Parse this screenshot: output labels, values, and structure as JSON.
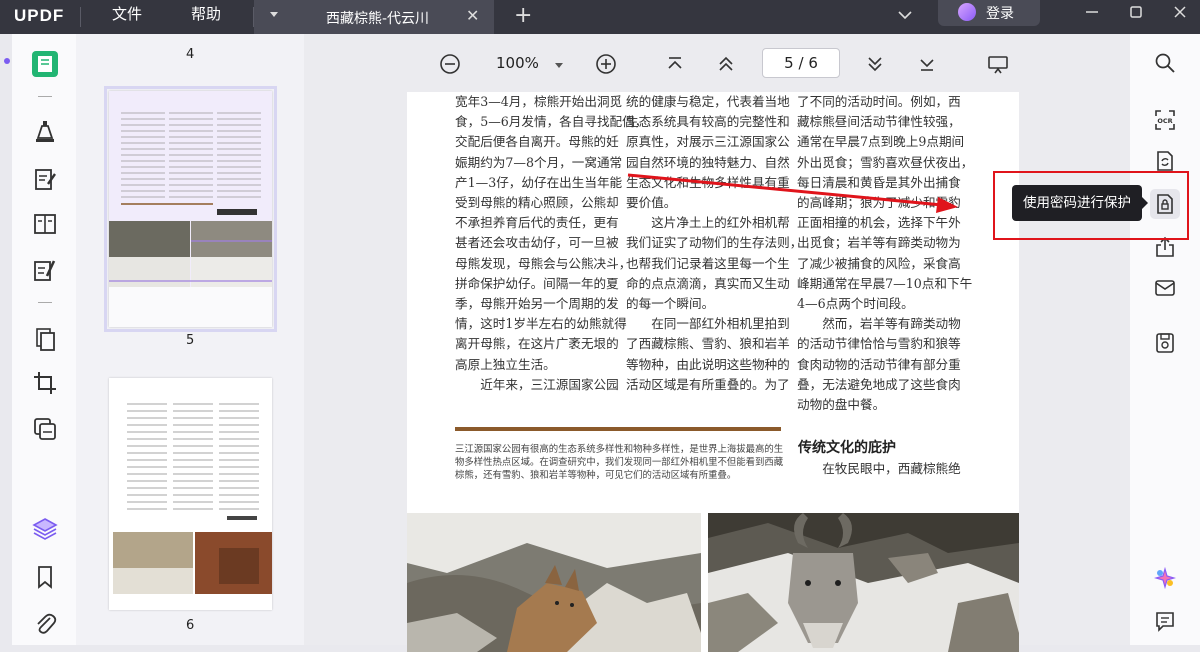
{
  "app": {
    "logo": "UPDF"
  },
  "menu": {
    "file": "文件",
    "help": "帮助"
  },
  "tab": {
    "title": "西藏棕熊-代云川"
  },
  "account": {
    "login_label": "登录"
  },
  "thumbnails": {
    "items": [
      {
        "page": "4"
      },
      {
        "page": "5"
      },
      {
        "page": "6"
      }
    ]
  },
  "toolbar": {
    "zoom": "100%",
    "page_current": "5",
    "page_total": "6",
    "page_sep": "/"
  },
  "tooltip": {
    "text": "使用密码进行保护"
  },
  "document": {
    "col1": [
      "宽年3—4月，棕熊开始出洞觅",
      "食，5—6月发情，各自寻找配偶，",
      "交配后便各自离开。母熊的妊",
      "娠期约为7—8个月，一窝通常",
      "产1—3仔，幼仔在出生当年能",
      "受到母熊的精心照顾，公熊却",
      "不承担养育后代的责任，更有",
      "甚者还会攻击幼仔，可一旦被",
      "母熊发现，母熊会与公熊决斗，",
      "拼命保护幼仔。间隔一年的夏",
      "季，母熊开始另一个周期的发",
      "情，这时1岁半左右的幼熊就得",
      "离开母熊，在这片广袤无垠的",
      "高原上独立生活。",
      "　　近年来，三江源国家公园"
    ],
    "col2": [
      "统的健康与稳定，代表着当地",
      "生态系统具有较高的完整性和",
      "原真性，对展示三江源国家公",
      "园自然环境的独特魅力、自然",
      "生态文化和生物多样性具有重",
      "要价值。",
      "　　这片净土上的红外相机帮",
      "我们证实了动物们的生存法则，",
      "也帮我们记录着这里每一个生",
      "命的点点滴滴，真实而又生动",
      "的每一个瞬间。",
      "　　在同一部红外相机里拍到",
      "了西藏棕熊、雪豹、狼和岩羊",
      "等物种，由此说明这些物种的",
      "活动区域是有所重叠的。为了"
    ],
    "col3": [
      "了不同的活动时间。例如，西",
      "藏棕熊昼间活动节律性较强，",
      "通常在早晨7点到晚上9点期间",
      "外出觅食；雪豹喜欢昼伏夜出，",
      "每日清晨和黄昏是其外出捕食",
      "的高峰期；狼为了减少和雪豹",
      "正面相撞的机会，选择下午外",
      "出觅食；岩羊等有蹄类动物为",
      "了减少被捕食的风险，采食高",
      "峰期通常在早晨7—10点和下午",
      "4—6点两个时间段。",
      "　　然而，岩羊等有蹄类动物",
      "的活动节律恰恰与雪豹和狼等",
      "食肉动物的活动节律有部分重",
      "叠，无法避免地成了这些食肉",
      "动物的盘中餐。"
    ],
    "caption": "三江源国家公园有很高的生态系统多样性和物种多样性，是世界上海拔最高的生物多样性热点区域。在调查研究中，我们发现同一部红外相机里不但能看到西藏棕熊，还有雪豹、狼和岩羊等物种，可见它们的活动区域有所重叠。",
    "heading": "传统文化的庇护",
    "col3_after_heading": "　　在牧民眼中，西藏棕熊绝"
  },
  "colors": {
    "titlebar": "#35363f",
    "accent": "#22b573",
    "annotation_red": "#e0141b",
    "caption_bar": "#8b5a2b"
  },
  "icons": {
    "left": [
      "reader-icon",
      "highlighter-icon",
      "edit-text-icon",
      "form-icon",
      "fill-sign-icon",
      "organize-pages-icon",
      "crop-icon",
      "protect-icon",
      "layers-icon",
      "bookmark-icon",
      "attachment-icon"
    ],
    "right": [
      "search-icon",
      "ocr-icon",
      "convert-icon",
      "password-protect-icon",
      "share-icon",
      "email-icon",
      "save-icon",
      "ai-assistant-icon",
      "comment-icon"
    ]
  }
}
